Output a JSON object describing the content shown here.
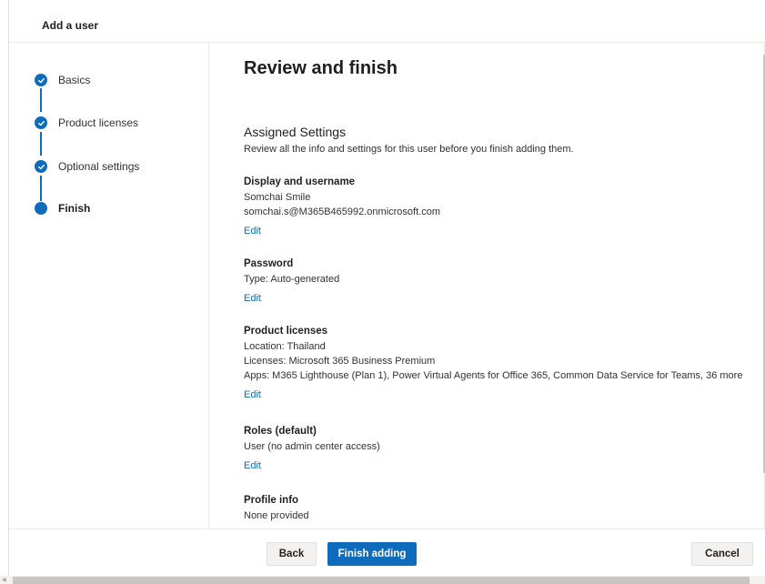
{
  "header": {
    "title": "Add a user"
  },
  "steps": [
    {
      "label": "Basics",
      "status": "complete"
    },
    {
      "label": "Product licenses",
      "status": "complete"
    },
    {
      "label": "Optional settings",
      "status": "complete"
    },
    {
      "label": "Finish",
      "status": "current"
    }
  ],
  "main": {
    "title": "Review and finish",
    "section_title": "Assigned Settings",
    "section_desc": "Review all the info and settings for this user before you finish adding them.",
    "groups": {
      "display": {
        "title": "Display and username",
        "lines": [
          "Somchai Smile",
          "somchai.s@M365B465992.onmicrosoft.com"
        ],
        "edit": "Edit"
      },
      "password": {
        "title": "Password",
        "lines": [
          "Type: Auto-generated"
        ],
        "edit": "Edit"
      },
      "licenses": {
        "title": "Product licenses",
        "lines": [
          "Location: Thailand",
          "Licenses: Microsoft 365 Business Premium",
          "Apps: M365 Lighthouse (Plan 1), Power Virtual Agents for Office 365, Common Data Service for Teams, 36 more"
        ],
        "edit": "Edit"
      },
      "roles": {
        "title": "Roles (default)",
        "lines": [
          "User (no admin center access)"
        ],
        "edit": "Edit"
      },
      "profile": {
        "title": "Profile info",
        "lines": [
          "None provided"
        ]
      }
    }
  },
  "footer": {
    "back_label": "Back",
    "finish_label": "Finish adding",
    "cancel_label": "Cancel"
  },
  "colors": {
    "accent": "#0f6cbd",
    "button_neutral": "#f3f2f1"
  },
  "icons": {
    "complete": "checkmark-icon",
    "current": "current-step-dot-icon"
  }
}
